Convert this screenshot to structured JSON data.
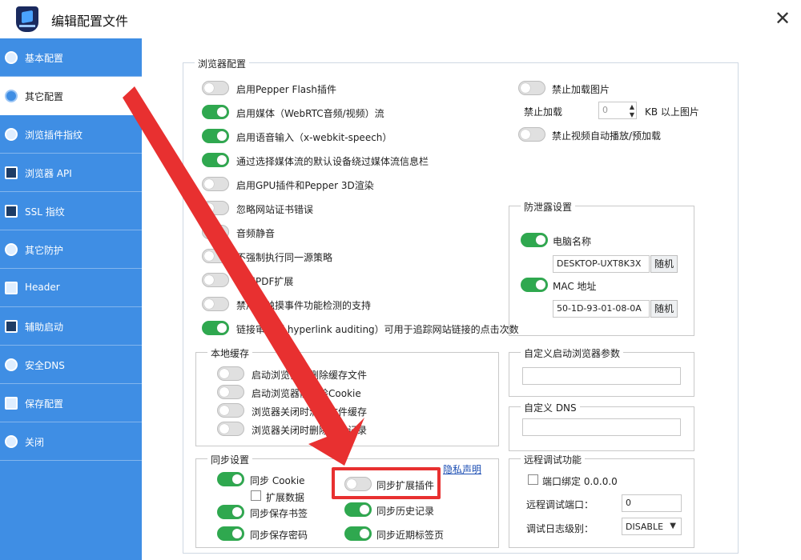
{
  "window": {
    "title": "编辑配置文件"
  },
  "sidebar": {
    "items": [
      {
        "label": "基本配置",
        "icon": "compass-icon",
        "active": false
      },
      {
        "label": "其它配置",
        "icon": "chrome-icon",
        "active": true
      },
      {
        "label": "浏览插件指纹",
        "icon": "puzzle-icon",
        "active": false
      },
      {
        "label": "浏览器 API",
        "icon": "api-icon",
        "active": false
      },
      {
        "label": "SSL 指纹",
        "icon": "lock-icon",
        "active": false
      },
      {
        "label": "其它防护",
        "icon": "shield-icon",
        "active": false
      },
      {
        "label": "Header",
        "icon": "header-icon",
        "active": false
      },
      {
        "label": "辅助启动",
        "icon": "cmd-icon",
        "active": false
      },
      {
        "label": "安全DNS",
        "icon": "globe-icon",
        "active": false
      },
      {
        "label": "保存配置",
        "icon": "save-icon",
        "active": false
      },
      {
        "label": "关闭",
        "icon": "close-circle-icon",
        "active": false
      }
    ]
  },
  "browser_config": {
    "legend": "浏览器配置",
    "toggles": [
      {
        "label": "启用Pepper Flash插件",
        "on": false
      },
      {
        "label": "启用媒体（WebRTC音频/视频）流",
        "on": true
      },
      {
        "label": "启用语音输入（x-webkit-speech）",
        "on": true
      },
      {
        "label": "通过选择媒体流的默认设备绕过媒体流信息栏",
        "on": true
      },
      {
        "label": "启用GPU插件和Pepper 3D渲染",
        "on": false
      },
      {
        "label": "忽略网站证书错误",
        "on": false
      },
      {
        "label": "音频静音",
        "on": false
      },
      {
        "label": "不强制执行同一源策略",
        "on": false
      },
      {
        "label": "禁用PDF扩展",
        "on": false
      },
      {
        "label": "禁用对触摸事件功能检测的支持",
        "on": false
      },
      {
        "label": "链接审计（ hyperlink auditing）可用于追踪网站链接的点击次数",
        "on": true
      }
    ],
    "right": {
      "block_images": {
        "label": "禁止加载图片",
        "on": false
      },
      "block_size": {
        "prefix": "禁止加载",
        "value": "0",
        "suffix": "KB 以上图片"
      },
      "block_autoplay": {
        "label": "禁止视频自动播放/预加载",
        "on": false
      }
    }
  },
  "leak_protection": {
    "legend": "防泄露设置",
    "computer_name": {
      "label": "电脑名称",
      "on": true,
      "value": "DESKTOP-UXT8K3X",
      "button": "随机"
    },
    "mac": {
      "label": "MAC 地址",
      "on": true,
      "value": "50-1D-93-01-08-0A",
      "button": "随机"
    }
  },
  "local_cache": {
    "legend": "本地缓存",
    "toggles": [
      {
        "label": "启动浏览器前删除缓存文件",
        "on": false
      },
      {
        "label": "启动浏览器前删除Cookie",
        "on": false
      },
      {
        "label": "浏览器关闭时清理文件缓存",
        "on": false
      },
      {
        "label": "浏览器关闭时删除历史记录",
        "on": false
      }
    ]
  },
  "custom_params": {
    "legend": "自定义启动浏览器参数",
    "value": ""
  },
  "custom_dns": {
    "legend": "自定义 DNS",
    "value": ""
  },
  "sync": {
    "legend": "同步设置",
    "privacy_link": "隐私声明",
    "cookie": {
      "label": "同步 Cookie",
      "on": true
    },
    "ext_data": {
      "label": "扩展数据",
      "checked": false
    },
    "bookmarks": {
      "label": "同步保存书签",
      "on": true
    },
    "passwords": {
      "label": "同步保存密码",
      "on": true
    },
    "extensions": {
      "label": "同步扩展插件",
      "on": false
    },
    "history": {
      "label": "同步历史记录",
      "on": true
    },
    "recent_tabs": {
      "label": "同步近期标签页",
      "on": true
    }
  },
  "remote_debug": {
    "legend": "远程调试功能",
    "bind": {
      "label": "端口绑定 0.0.0.0",
      "checked": false
    },
    "port": {
      "label": "远程调试端口：",
      "value": "0"
    },
    "log_level": {
      "label": "调试日志级别：",
      "value": "DISABLE"
    }
  },
  "annotation": {
    "color": "#e83030"
  }
}
